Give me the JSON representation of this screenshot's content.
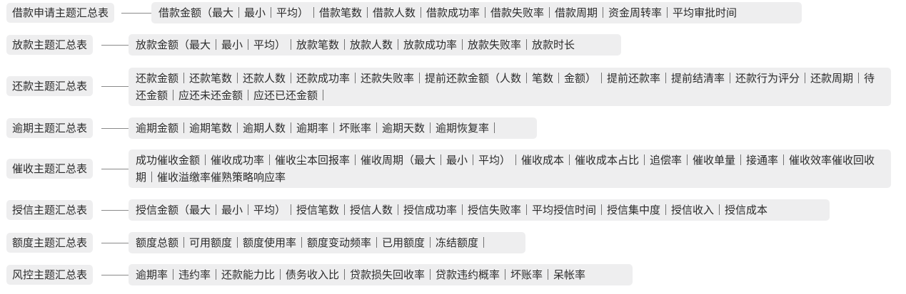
{
  "rows": [
    {
      "topic": "借款申请主题汇总表",
      "metrics": "借款金额（最大｜最小｜平均）｜借款笔数｜借款人数｜借款成功率｜借款失败率｜借款周期｜资金周转率｜平均审批时间"
    },
    {
      "topic": "放款主题汇总表",
      "metrics": "放款金额（最大｜最小｜平均）｜放款笔数｜放款人数｜放款成功率｜放款失败率｜放款时长"
    },
    {
      "topic": "还款主题汇总表",
      "metrics": "还款金额｜还款笔数｜还款人数｜还款成功率｜还款失败率｜提前还款金额（人数｜笔数｜金额）｜提前还款率｜提前结清率｜还款行为评分｜还款周期｜待还金额｜应还未还金额｜应还已还金额｜"
    },
    {
      "topic": "逾期主题汇总表",
      "metrics": "逾期金额｜逾期笔数｜逾期人数｜逾期率｜坏账率｜逾期天数｜逾期恢复率｜"
    },
    {
      "topic": "催收主题汇总表",
      "metrics": "成功催收金额｜催收成功率｜催收尘本回报率｜催收周期（最大｜最小｜平均）｜催收成本｜催收成本占比｜追偿率｜催收单量｜接通率｜催收效率催收回收期｜催收溢缴率催熟策略响应率"
    },
    {
      "topic": "授信主题汇总表",
      "metrics": "授信金额（最大｜最小｜平均）｜授信笔数｜授信人数｜授信成功率｜授信失败率｜平均授信时间｜授信集中度｜授信收入｜授信成本"
    },
    {
      "topic": "额度主题汇总表",
      "metrics": "额度总额｜可用额度｜额度使用率｜额度变动频率｜已用额度｜冻结额度｜"
    },
    {
      "topic": "风控主题汇总表",
      "metrics": "逾期率｜违约率｜还款能力比｜债务收入比｜贷款损失回收率｜贷款违约概率｜坏账率｜呆帐率"
    }
  ]
}
